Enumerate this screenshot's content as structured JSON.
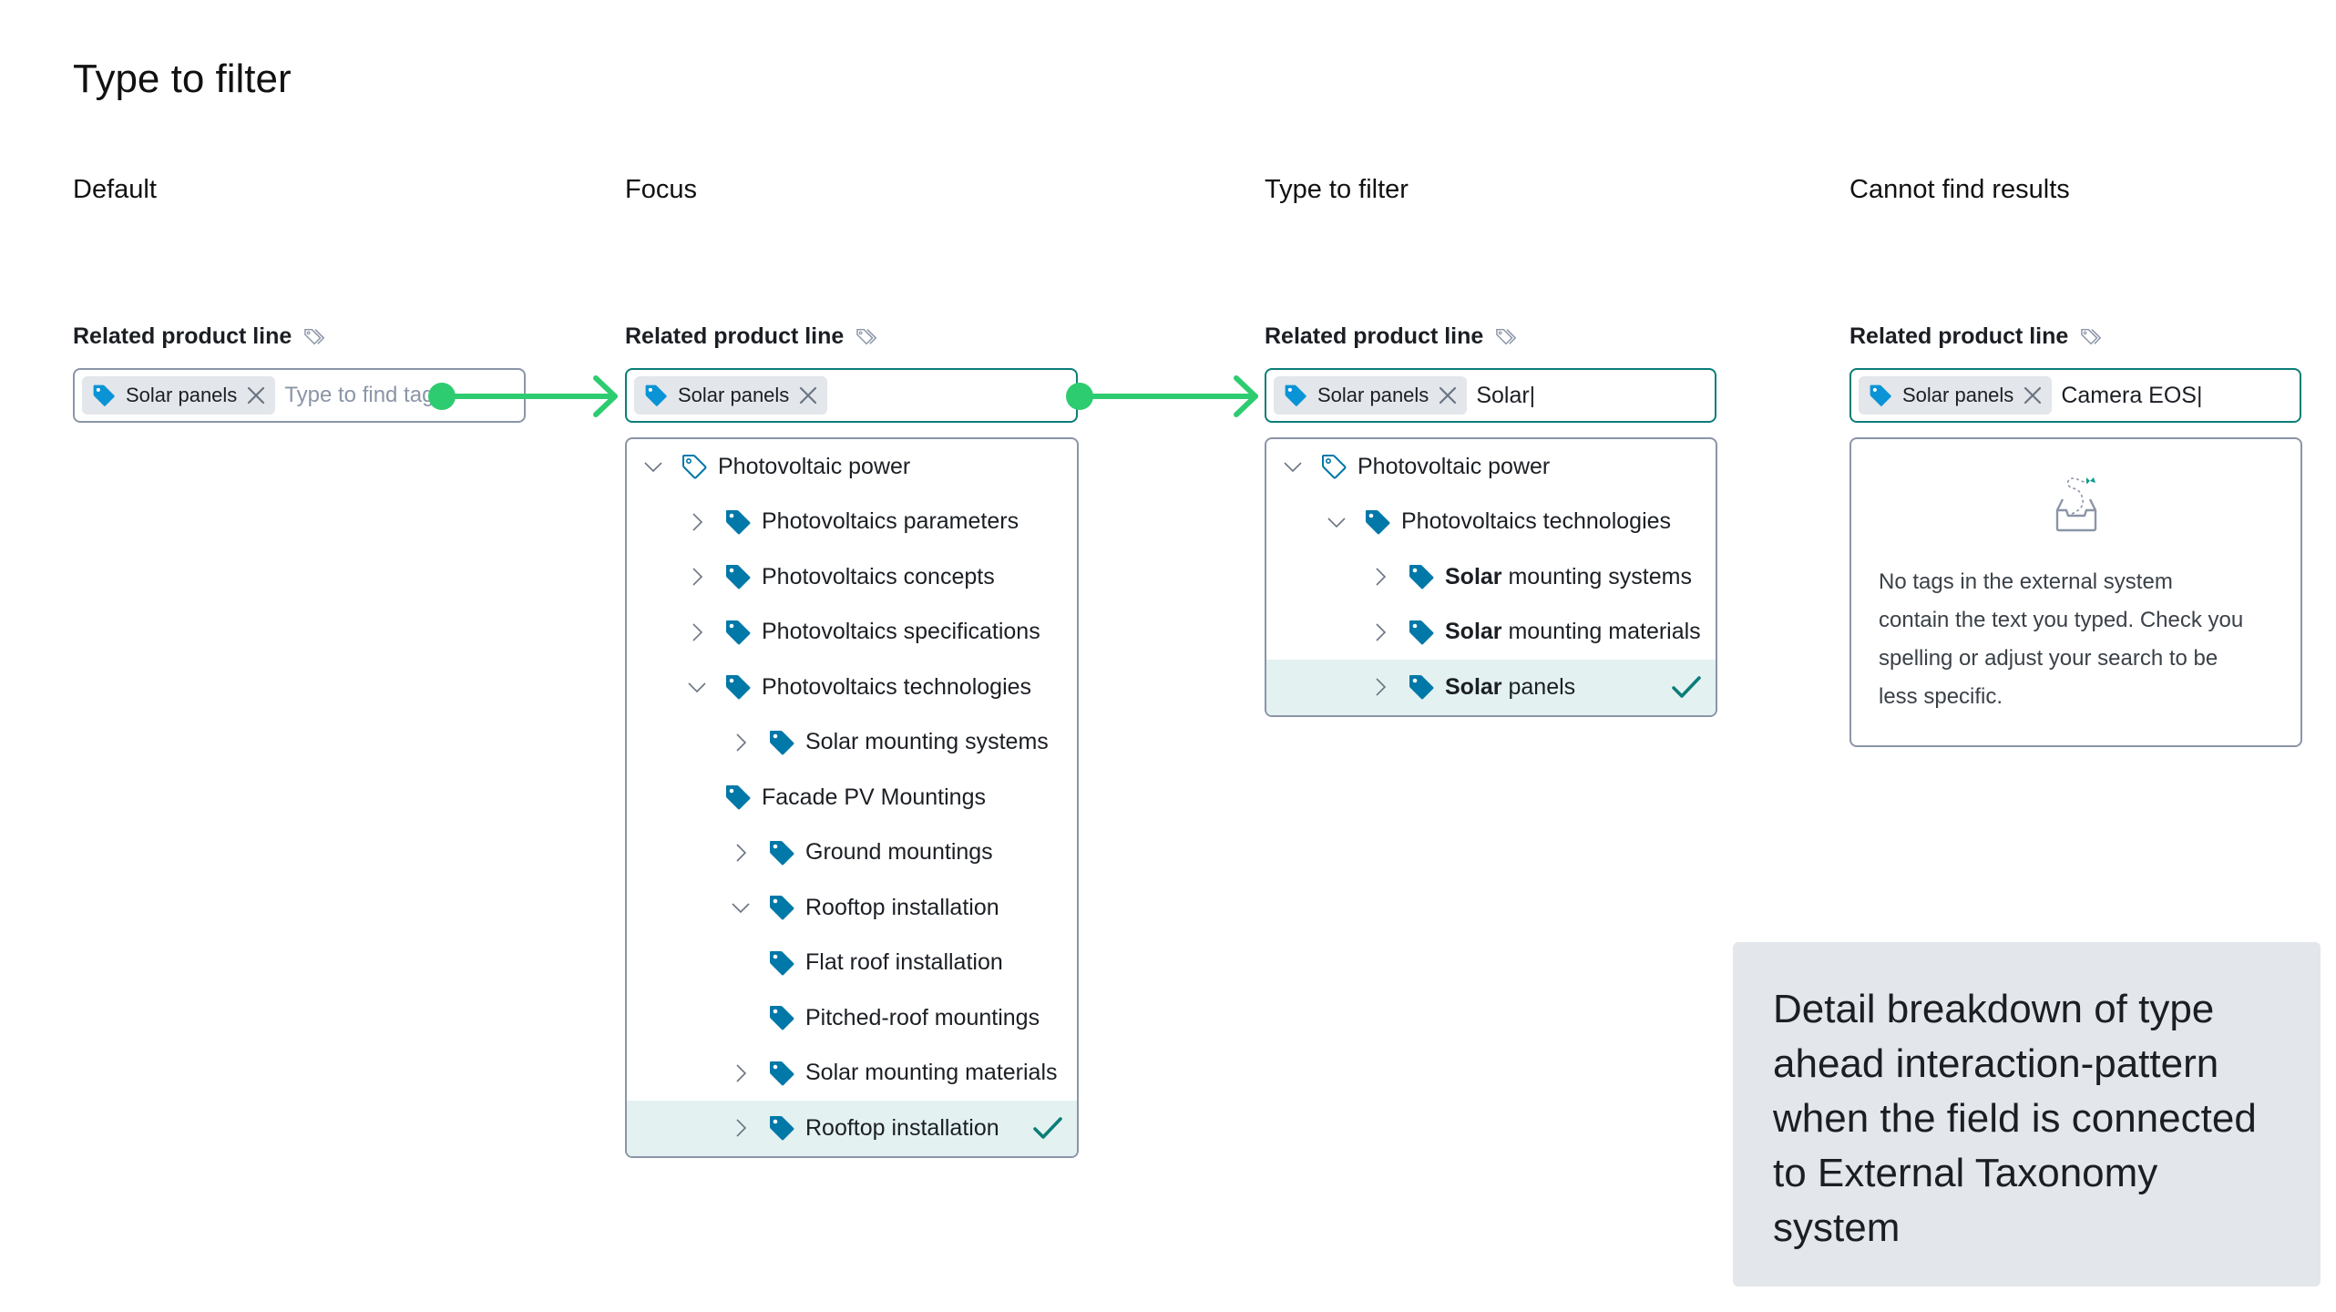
{
  "page": {
    "title": "Type to filter"
  },
  "colors": {
    "accent_teal": "#0b7d78",
    "tag_blue": "#0078a8",
    "connector_green": "#2ecc71",
    "border_gray": "#8b95a7",
    "selected_row_bg": "#e3f1f1",
    "chip_bg": "#e3e6ea"
  },
  "states": [
    {
      "label": "Default",
      "field_label": "Related product line",
      "chip": {
        "label": "Solar panels",
        "icon": "tag-filled-icon",
        "remove_icon": "close-icon"
      },
      "input": {
        "value": "",
        "placeholder": "Type to find tags"
      }
    },
    {
      "label": "Focus",
      "field_label": "Related product line",
      "chip": {
        "label": "Solar panels",
        "icon": "tag-filled-icon",
        "remove_icon": "close-icon"
      },
      "input": {
        "value": ""
      },
      "tree": [
        {
          "label": "Photovoltaic power",
          "expand": "expanded",
          "icon": "tag-outline-icon",
          "level": 0
        },
        {
          "label": "Photovoltaics parameters",
          "expand": "collapsed",
          "icon": "tag-filled-icon",
          "level": 1
        },
        {
          "label": "Photovoltaics concepts",
          "expand": "collapsed",
          "icon": "tag-filled-icon",
          "level": 1
        },
        {
          "label": "Photovoltaics specifications",
          "expand": "collapsed",
          "icon": "tag-filled-icon",
          "level": 1
        },
        {
          "label": "Photovoltaics technologies",
          "expand": "expanded",
          "icon": "tag-filled-icon",
          "level": 1
        },
        {
          "label": "Solar mounting systems",
          "expand": "collapsed",
          "icon": "tag-filled-icon",
          "level": 2
        },
        {
          "label": "Facade PV Mountings",
          "expand": "none",
          "icon": "tag-filled-icon",
          "level": 1
        },
        {
          "label": "Ground mountings",
          "expand": "collapsed",
          "icon": "tag-filled-icon",
          "level": 2
        },
        {
          "label": "Rooftop installation",
          "expand": "expanded",
          "icon": "tag-filled-icon",
          "level": 2
        },
        {
          "label": "Flat roof installation",
          "expand": "none",
          "icon": "tag-filled-icon",
          "level": 2
        },
        {
          "label": "Pitched-roof mountings",
          "expand": "none",
          "icon": "tag-filled-icon",
          "level": 2
        },
        {
          "label": "Solar mounting materials",
          "expand": "collapsed",
          "icon": "tag-filled-icon",
          "level": 2
        },
        {
          "label": "Rooftop installation",
          "expand": "collapsed",
          "icon": "tag-filled-icon",
          "level": 2,
          "selected": true
        }
      ]
    },
    {
      "label": "Type to filter",
      "field_label": "Related product line",
      "chip": {
        "label": "Solar panels",
        "icon": "tag-filled-icon",
        "remove_icon": "close-icon"
      },
      "input": {
        "value": "Solar|"
      },
      "tree": [
        {
          "label": "Photovoltaic power",
          "expand": "expanded",
          "icon": "tag-outline-icon",
          "level": 0
        },
        {
          "label": "Photovoltaics technologies",
          "expand": "expanded",
          "icon": "tag-filled-icon",
          "level": 1
        },
        {
          "match": "Solar",
          "rest": " mounting systems",
          "expand": "collapsed",
          "icon": "tag-filled-icon",
          "level": 2
        },
        {
          "match": "Solar",
          "rest": " mounting materials",
          "expand": "collapsed",
          "icon": "tag-filled-icon",
          "level": 2
        },
        {
          "match": "Solar",
          "rest": " panels",
          "expand": "collapsed",
          "icon": "tag-filled-icon",
          "level": 2,
          "selected": true
        }
      ]
    },
    {
      "label": "Cannot find results",
      "field_label": "Related product line",
      "chip": {
        "label": "Solar panels",
        "icon": "tag-filled-icon",
        "remove_icon": "close-icon"
      },
      "input": {
        "value": "Camera EOS|"
      },
      "empty_state": {
        "icon": "empty-inbox-icon",
        "lines": [
          "No tags in the external system",
          "contain the text you typed. Check you",
          "spelling or adjust your search to be",
          "less specific."
        ]
      }
    }
  ],
  "note": {
    "text": "Detail breakdown of type ahead interaction-pattern when the field is connected to External Taxonomy system"
  }
}
